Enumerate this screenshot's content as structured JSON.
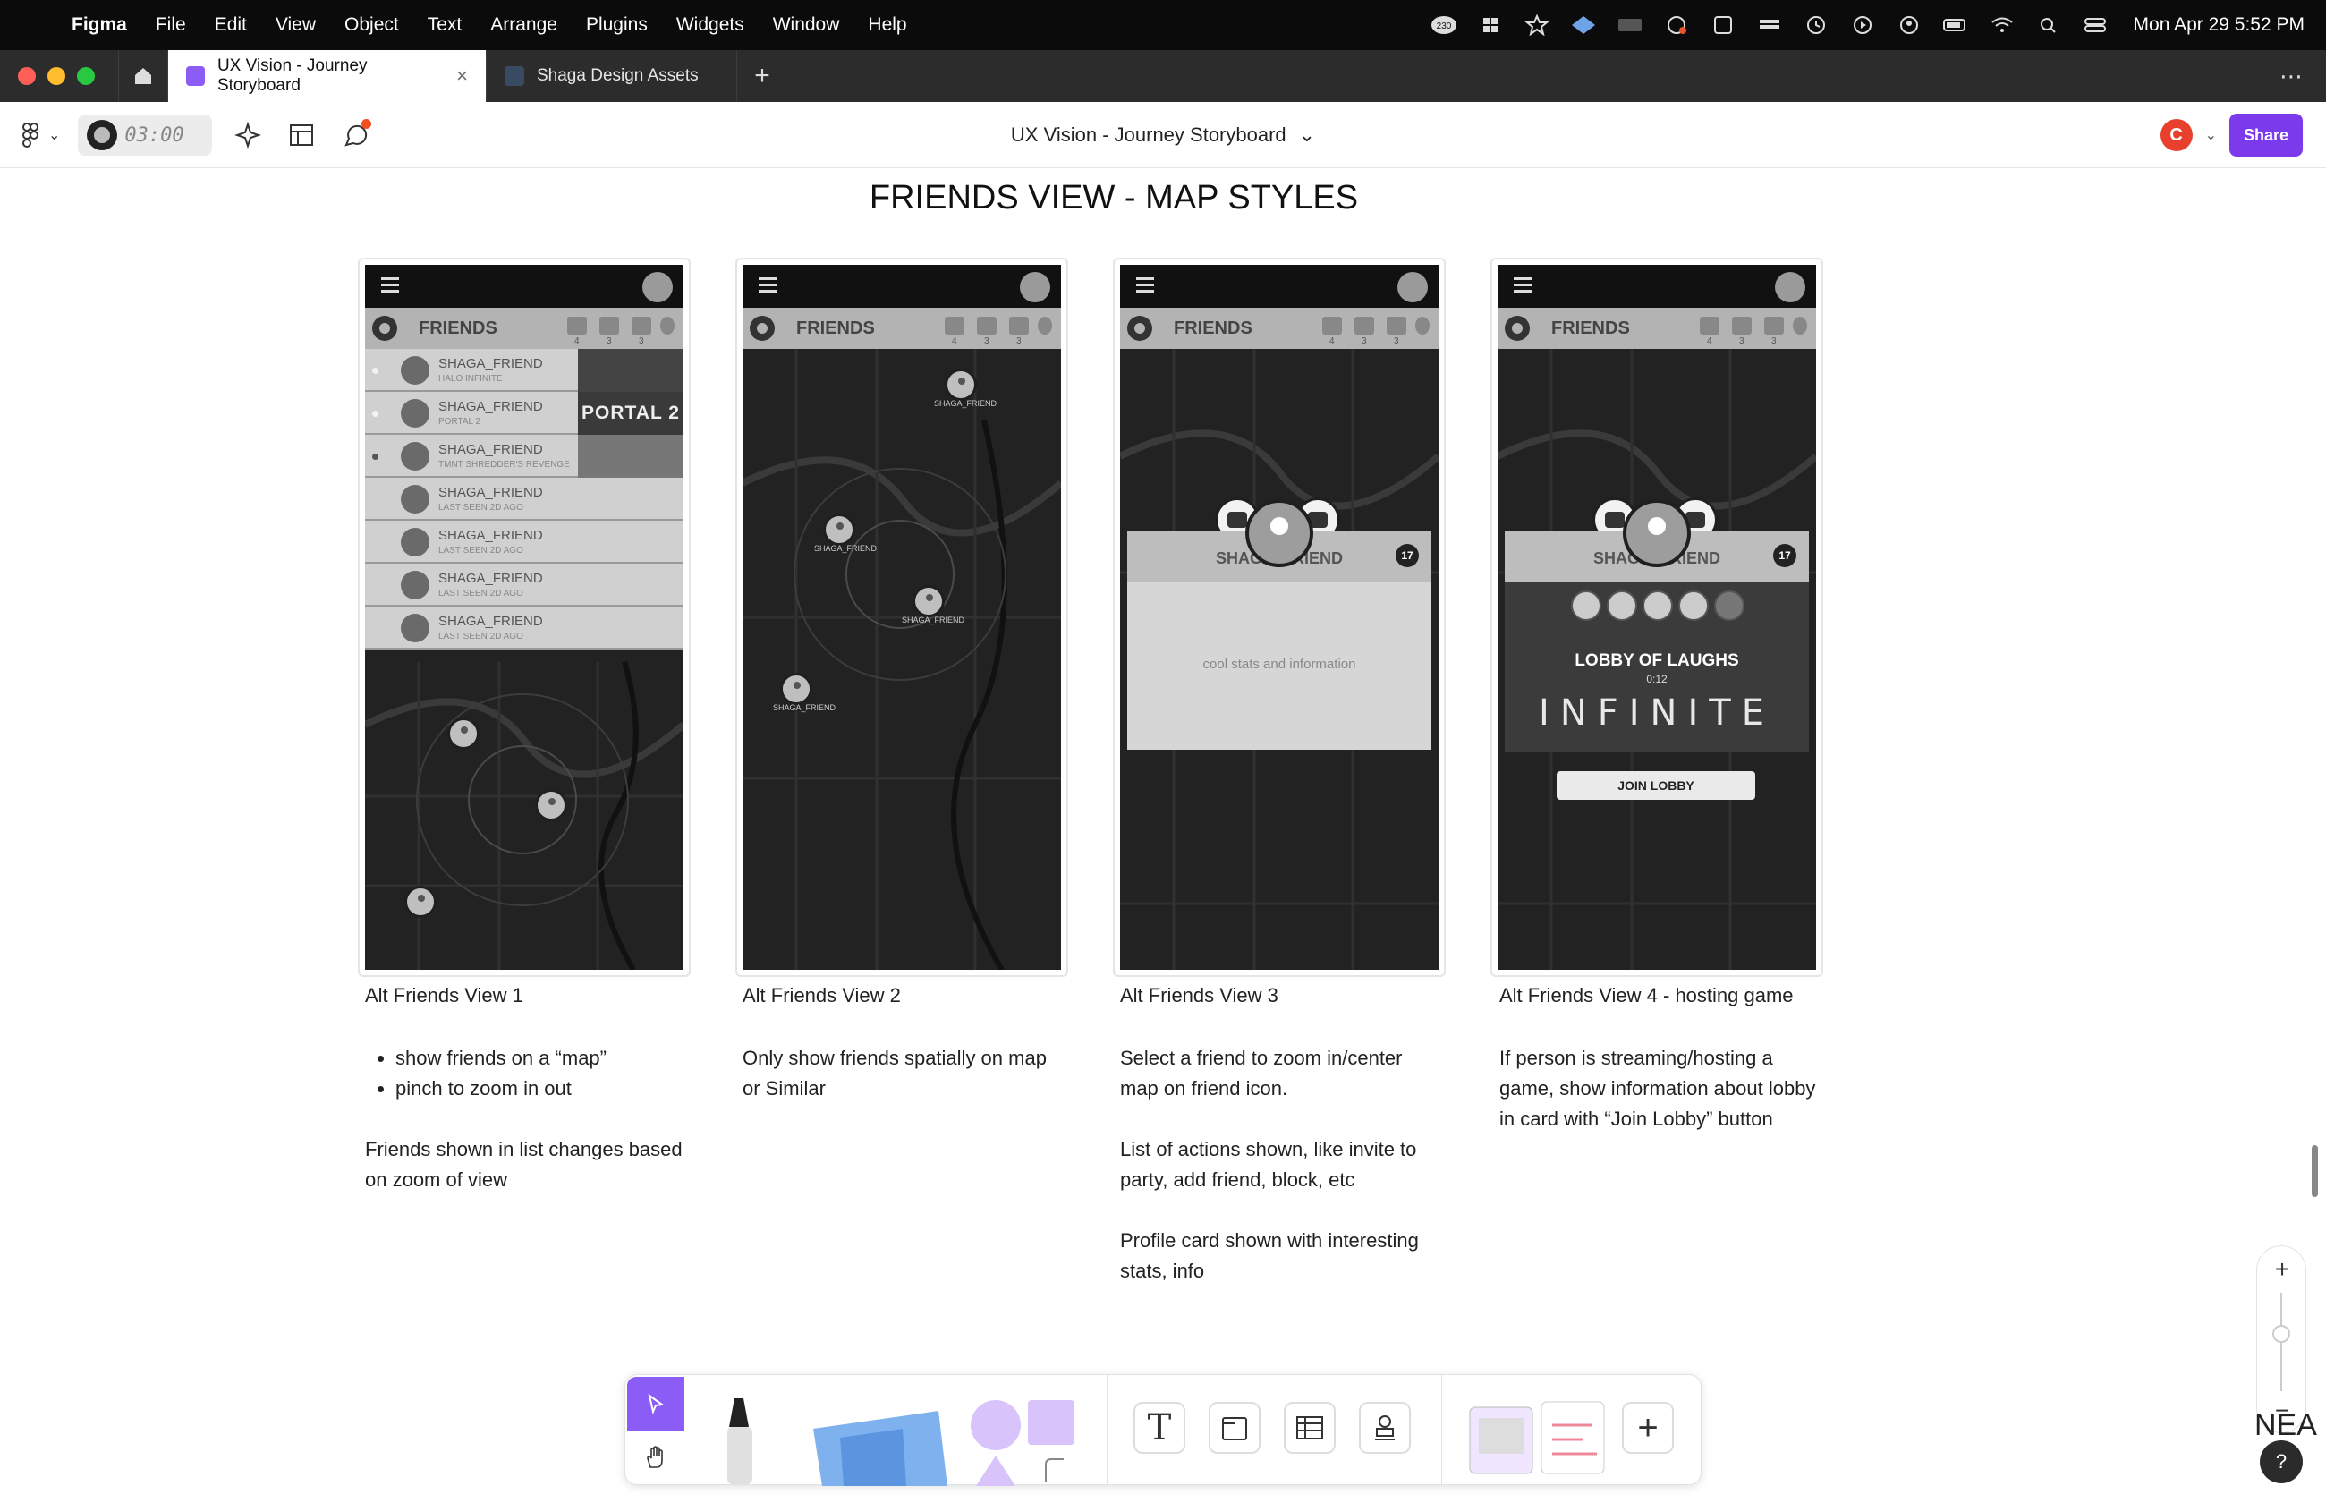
{
  "menubar": {
    "app": "Figma",
    "items": [
      "File",
      "Edit",
      "View",
      "Object",
      "Text",
      "Arrange",
      "Plugins",
      "Widgets",
      "Window",
      "Help"
    ],
    "badge": "230",
    "clock": "Mon Apr 29  5:52 PM"
  },
  "tabs": [
    {
      "label": "UX Vision - Journey Storyboard",
      "active": true
    },
    {
      "label": "Shaga Design Assets",
      "active": false
    }
  ],
  "toolbar": {
    "timer": "03:00",
    "doc_title": "UX Vision - Journey Storyboard",
    "avatar_initial": "C",
    "share_label": "Share"
  },
  "canvas": {
    "section_title": "FRIENDS VIEW - MAP STYLES",
    "phone_header_title": "FRIENDS",
    "header_counts": [
      "4",
      "3",
      "3"
    ],
    "views": [
      {
        "caption": "Alt Friends View 1",
        "bullets": [
          "show friends on a “map”",
          "pinch to zoom in out"
        ],
        "paragraphs": [
          "Friends shown in list changes based on zoom of view"
        ]
      },
      {
        "caption": "Alt Friends View 2",
        "bullets": [],
        "paragraphs": [
          "Only show friends spatially on map or Similar"
        ]
      },
      {
        "caption": "Alt Friends View 3",
        "bullets": [],
        "paragraphs": [
          "Select a friend to zoom in/center map on friend icon.",
          "List of actions shown, like invite to party, add friend, block, etc",
          "Profile card shown with interesting stats, info"
        ]
      },
      {
        "caption": "Alt Friends View 4 - hosting game",
        "bullets": [],
        "paragraphs": [
          "If person is streaming/hosting a game, show information about lobby in card with “Join Lobby” button"
        ]
      }
    ],
    "friend_list": [
      {
        "name": "SHAGA_FRIEND",
        "sub": "HALO INFINITE",
        "game": ""
      },
      {
        "name": "SHAGA_FRIEND",
        "sub": "PORTAL 2",
        "game": "PORTAL 2"
      },
      {
        "name": "SHAGA_FRIEND",
        "sub": "TMNT SHREDDER'S REVENGE",
        "game": ""
      },
      {
        "name": "SHAGA_FRIEND",
        "sub": "LAST SEEN 2D AGO",
        "game": ""
      },
      {
        "name": "SHAGA_FRIEND",
        "sub": "LAST SEEN 2D AGO",
        "game": ""
      },
      {
        "name": "SHAGA_FRIEND",
        "sub": "LAST SEEN 2D AGO",
        "game": ""
      },
      {
        "name": "SHAGA_FRIEND",
        "sub": "LAST SEEN 2D AGO",
        "game": ""
      }
    ],
    "map_label": "SHAGA_FRIEND",
    "profile_name": "SHAGA_FRIEND",
    "profile_level": "17",
    "profile_stats": "cool stats and information",
    "lobby_title": "LOBBY OF LAUGHS",
    "lobby_time": "0:12",
    "lobby_game": "INFINITE",
    "join_label": "JOIN LOBBY"
  },
  "corner_text": "NEA",
  "help_label": "?"
}
